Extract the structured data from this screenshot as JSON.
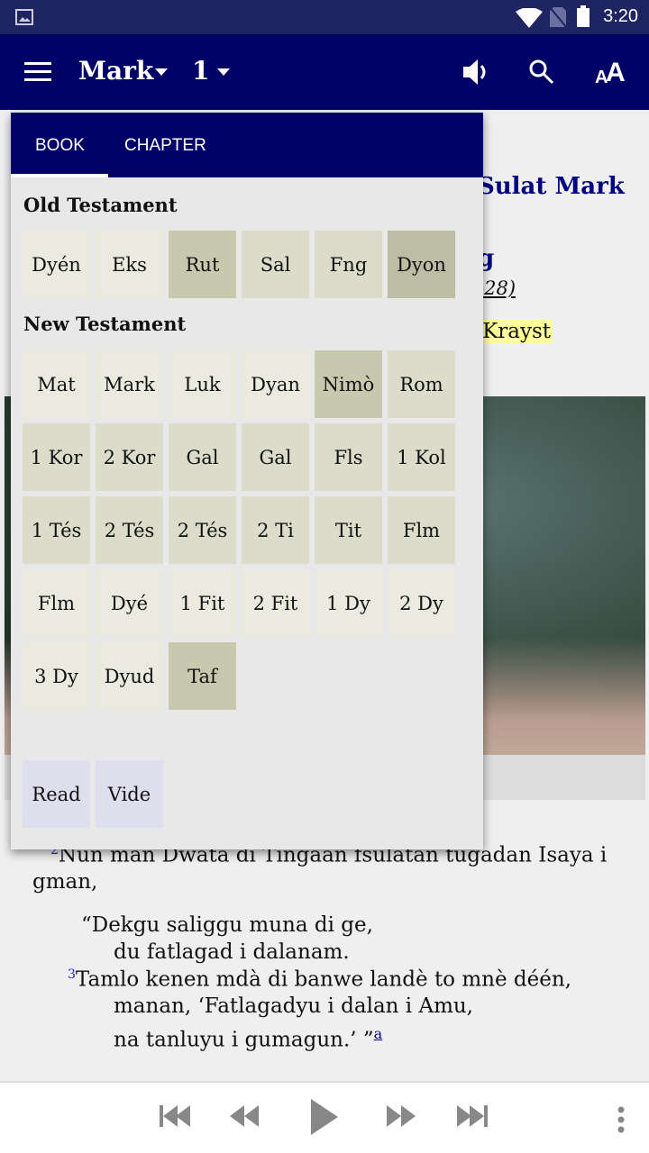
{
  "status": {
    "time": "3:20",
    "icons": [
      "image-icon",
      "wifi-icon",
      "no-sim-icon",
      "battery-icon"
    ]
  },
  "appbar": {
    "book": "Mark",
    "chapter": "1",
    "icons": [
      "menu-icon",
      "speaker-icon",
      "search-icon",
      "text-size-icon"
    ]
  },
  "background": {
    "heading_fragment": "Sulat Mark",
    "subheading_fragment": "g",
    "ref_fragment": "-28)",
    "highlight_fragment": "s Krayst",
    "verses": [
      {
        "num": "2",
        "text": "Nun man Dwata di Tingaan fsulatan tugadan Isaya i"
      },
      {
        "num": "",
        "text": "gman,"
      }
    ],
    "poetry": [
      "“Dekgu saliggu muna di ge,",
      "du fatlagad i dalanam."
    ],
    "verse3_num": "3",
    "verse3": [
      "Tamlo kenen mdà di banwe landè to mnè déén,",
      "manan, ‘Fatlagadyu i dalan i Amu,",
      "na tanluyu i gumagun.’ ”"
    ],
    "footnote": "a",
    "highlight_color": "#ffff99"
  },
  "dialog": {
    "tabs": [
      {
        "label": "BOOK",
        "active": true
      },
      {
        "label": "CHAPTER",
        "active": false
      }
    ],
    "old_testament_label": "Old Testament",
    "old_testament": [
      {
        "label": "Dyén",
        "shade": 0
      },
      {
        "label": "Eks",
        "shade": 0
      },
      {
        "label": "Rut",
        "shade": 2
      },
      {
        "label": "Sal",
        "shade": 1
      },
      {
        "label": "Fng",
        "shade": 1
      },
      {
        "label": "Dyon",
        "shade": 3
      }
    ],
    "new_testament_label": "New Testament",
    "new_testament": [
      {
        "label": "Mat",
        "shade": 0
      },
      {
        "label": "Mark",
        "shade": 0
      },
      {
        "label": "Luk",
        "shade": 0
      },
      {
        "label": "Dyan",
        "shade": 0
      },
      {
        "label": "Nimò",
        "shade": 2
      },
      {
        "label": "Rom",
        "shade": 1
      },
      {
        "label": "1 Kor",
        "shade": 1
      },
      {
        "label": "2 Kor",
        "shade": 1
      },
      {
        "label": "Gal",
        "shade": 1
      },
      {
        "label": "Gal",
        "shade": 1
      },
      {
        "label": "Fls",
        "shade": 1
      },
      {
        "label": "1 Kol",
        "shade": 1
      },
      {
        "label": "1 Tés",
        "shade": 1
      },
      {
        "label": "2 Tés",
        "shade": 1
      },
      {
        "label": "2 Tés",
        "shade": 1
      },
      {
        "label": "2 Ti",
        "shade": 1
      },
      {
        "label": "Tit",
        "shade": 1
      },
      {
        "label": "Flm",
        "shade": 1
      },
      {
        "label": "Flm",
        "shade": 0
      },
      {
        "label": "Dyé",
        "shade": 0
      },
      {
        "label": "1 Fit",
        "shade": 0
      },
      {
        "label": "2 Fit",
        "shade": 0
      },
      {
        "label": "1 Dy",
        "shade": 0
      },
      {
        "label": "2 Dy",
        "shade": 0
      },
      {
        "label": "3 Dy",
        "shade": 0
      },
      {
        "label": "Dyud",
        "shade": 0
      },
      {
        "label": "Taf",
        "shade": 2
      }
    ],
    "buttons": [
      {
        "label": "Read"
      },
      {
        "label": "Vide"
      }
    ]
  },
  "player": {
    "icons": [
      "skip-start-icon",
      "rewind-icon",
      "play-icon",
      "fast-forward-icon",
      "skip-end-icon",
      "more-icon"
    ]
  }
}
